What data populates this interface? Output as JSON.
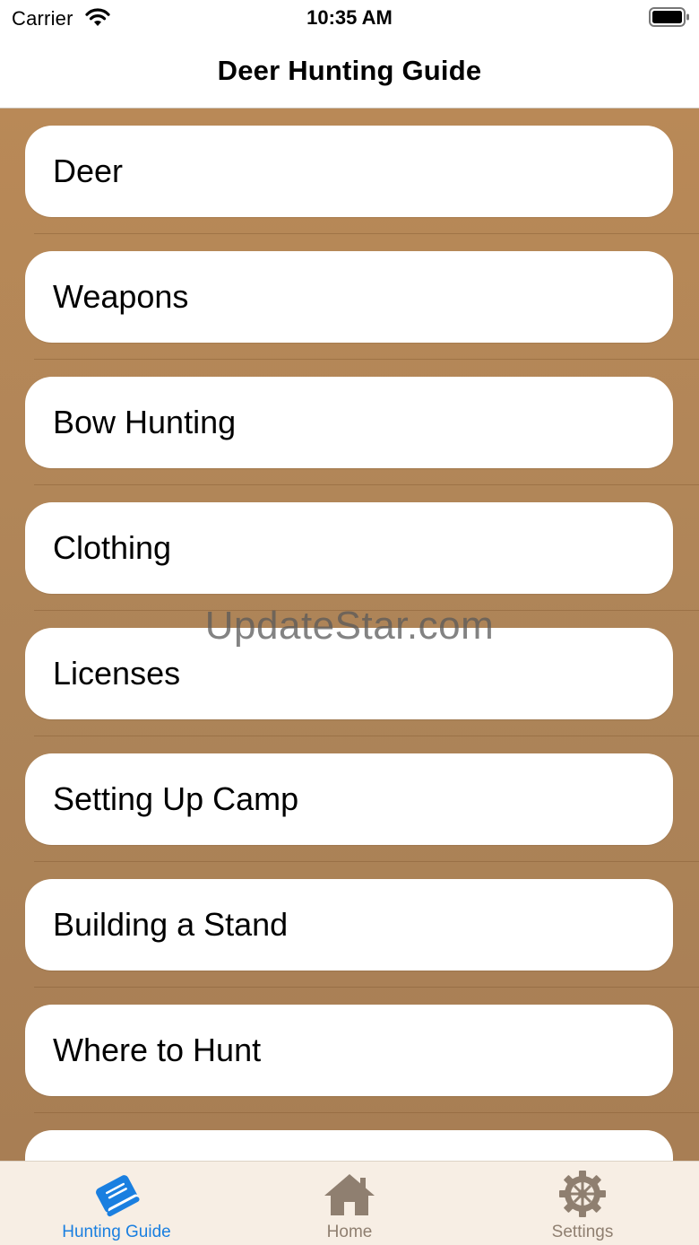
{
  "status_bar": {
    "carrier": "Carrier",
    "time": "10:35 AM",
    "wifi_icon": "wifi-icon",
    "battery_icon": "battery-icon"
  },
  "nav": {
    "title": "Deer Hunting Guide"
  },
  "menu": {
    "items": [
      {
        "label": "Deer"
      },
      {
        "label": "Weapons"
      },
      {
        "label": "Bow Hunting"
      },
      {
        "label": "Clothing"
      },
      {
        "label": "Licenses"
      },
      {
        "label": "Setting Up Camp"
      },
      {
        "label": "Building a Stand"
      },
      {
        "label": "Where to Hunt"
      },
      {
        "label": ""
      }
    ]
  },
  "watermark": "UpdateStar.com",
  "tab_bar": {
    "tabs": [
      {
        "label": "Hunting Guide",
        "icon": "book-icon",
        "selected": true
      },
      {
        "label": "Home",
        "icon": "house-icon",
        "selected": false
      },
      {
        "label": "Settings",
        "icon": "gear-icon",
        "selected": false
      }
    ]
  },
  "colors": {
    "background_brown": "#b98957",
    "tab_active": "#1a7fe0",
    "tab_inactive": "#8f7f70",
    "tab_bar_bg": "#f7eee4",
    "card_bg": "#ffffff"
  }
}
